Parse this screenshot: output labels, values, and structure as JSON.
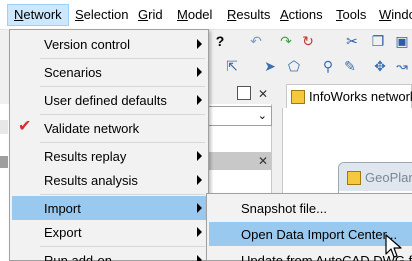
{
  "menubar": {
    "items": [
      {
        "label": "Network",
        "mnemonic": "N"
      },
      {
        "label": "Selection",
        "mnemonic": "S"
      },
      {
        "label": "Grid",
        "mnemonic": "G"
      },
      {
        "label": "Model",
        "mnemonic": "M"
      },
      {
        "label": "Results",
        "mnemonic": "R"
      },
      {
        "label": "Actions",
        "mnemonic": "A"
      },
      {
        "label": "Tools",
        "mnemonic": "T"
      },
      {
        "label": "Windo",
        "mnemonic": "W"
      }
    ]
  },
  "network_menu": {
    "items": [
      {
        "label": "Version control",
        "submenu": true,
        "checked": false
      },
      {
        "label": "Scenarios",
        "submenu": true,
        "checked": false
      },
      {
        "label": "User defined defaults",
        "submenu": true,
        "checked": false
      },
      {
        "label": "Validate network",
        "submenu": false,
        "checked": true
      },
      {
        "label": "Results replay",
        "submenu": true,
        "checked": false
      },
      {
        "label": "Results analysis",
        "submenu": true,
        "checked": false
      },
      {
        "label": "Import",
        "submenu": true,
        "checked": false,
        "highlighted": true
      },
      {
        "label": "Export",
        "submenu": true,
        "checked": false
      },
      {
        "label": "Run add-on",
        "submenu": true,
        "checked": false
      }
    ]
  },
  "import_submenu": {
    "items": [
      {
        "label": "Snapshot file..."
      },
      {
        "label": "Open Data Import Center...",
        "highlighted": true
      },
      {
        "label": "Update from AutoCAD DWG file"
      }
    ]
  },
  "document": {
    "tab_title": "InfoWorks network",
    "inner_window_title": "GeoPlan"
  },
  "colors": {
    "menu_highlight": "#99c9ef",
    "menubar_active": "#cce8ff",
    "check": "#d32f2f"
  }
}
